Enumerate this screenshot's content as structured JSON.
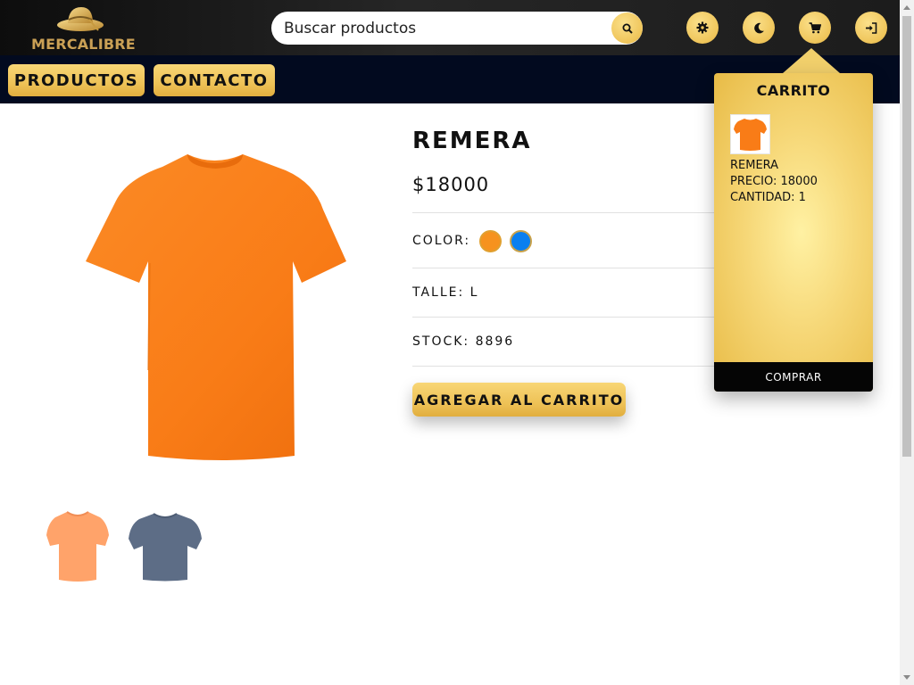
{
  "header": {
    "logo_text": "MERCALIBRE",
    "search": {
      "placeholder": "Buscar productos",
      "value": ""
    },
    "icons": [
      "search-icon",
      "gear-icon",
      "moon-icon",
      "cart-icon",
      "login-icon"
    ]
  },
  "nav": {
    "items": [
      {
        "label": "PRODUCTOS"
      },
      {
        "label": "CONTACTO"
      }
    ]
  },
  "product": {
    "title": "REMERA",
    "price": "$18000",
    "color_label": "COLOR:",
    "colors": [
      "#f6921e",
      "#0a7ff0"
    ],
    "size": "TALLE: L",
    "stock": "STOCK: 8896",
    "add_to_cart_label": "AGREGAR AL CARRITO",
    "main_image_color": "#f97c17",
    "thumbnails": [
      {
        "color": "#ffa36a"
      },
      {
        "color": "#5d6d86"
      }
    ]
  },
  "cart": {
    "title": "CARRITO",
    "items": [
      {
        "name": "REMERA",
        "price": "PRECIO: 18000",
        "quantity": "CANTIDAD: 1"
      }
    ],
    "buy_label": "COMPRAR"
  },
  "colors": {
    "header_bg": "#1a1a1a",
    "nav_bg": "#020a1f",
    "gold": "#efc55a",
    "black": "#050505"
  }
}
